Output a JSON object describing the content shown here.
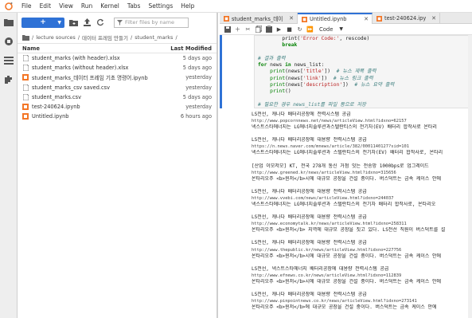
{
  "menu": [
    "File",
    "Edit",
    "View",
    "Run",
    "Kernel",
    "Tabs",
    "Settings",
    "Help"
  ],
  "filebrowser": {
    "new_label": "+",
    "filter_placeholder": "Filter files by name",
    "breadcrumb": [
      "/",
      "lecture sources",
      "/",
      "데이터 프레임 만들기",
      "/",
      "student_marks",
      "/"
    ],
    "col_name": "Name",
    "col_modified": "Last Modified",
    "files": [
      {
        "name": "student_marks (with header).xlsx",
        "modified": "5 days ago",
        "type": "file"
      },
      {
        "name": "student_marks (without header).xlsx",
        "modified": "5 days ago",
        "type": "file"
      },
      {
        "name": "student_marks_데이터 프레임 기초 명령어.ipynb",
        "modified": "yesterday",
        "type": "notebook"
      },
      {
        "name": "student_marks_csv saved.csv",
        "modified": "yesterday",
        "type": "file"
      },
      {
        "name": "student_marks.csv",
        "modified": "5 days ago",
        "type": "file"
      },
      {
        "name": "test-240624.ipynb",
        "modified": "yesterday",
        "type": "notebook"
      },
      {
        "name": "Untitled.ipynb",
        "modified": "6 hours ago",
        "type": "notebook-running"
      }
    ]
  },
  "tabs": [
    {
      "label": "student_marks_데이터 프레임",
      "active": false
    },
    {
      "label": "Untitled.ipynb",
      "active": true
    },
    {
      "label": "test-240624.ipynb",
      "active": false
    }
  ],
  "notebook_toolbar": {
    "cell_type": "Code"
  },
  "code_lines": [
    [
      {
        "t": "        print(",
        "c": ""
      },
      {
        "t": "'Error Code:'",
        "c": "str"
      },
      {
        "t": ", rescode)",
        "c": ""
      }
    ],
    [
      {
        "t": "        ",
        "c": ""
      },
      {
        "t": "break",
        "c": "kw"
      }
    ],
    [
      {
        "t": "",
        "c": ""
      }
    ],
    [
      {
        "t": "# 결과 출력",
        "c": "cm"
      }
    ],
    [
      {
        "t": "for",
        "c": "kw"
      },
      {
        "t": " news ",
        "c": ""
      },
      {
        "t": "in",
        "c": "kw"
      },
      {
        "t": " news_list:",
        "c": ""
      }
    ],
    [
      {
        "t": "    ",
        "c": ""
      },
      {
        "t": "print",
        "c": "fn"
      },
      {
        "t": "(news[",
        "c": ""
      },
      {
        "t": "'title'",
        "c": "str"
      },
      {
        "t": "])  ",
        "c": ""
      },
      {
        "t": "# 뉴스 제목 출력",
        "c": "cm"
      }
    ],
    [
      {
        "t": "    ",
        "c": ""
      },
      {
        "t": "print",
        "c": "fn"
      },
      {
        "t": "(news[",
        "c": ""
      },
      {
        "t": "'link'",
        "c": "str"
      },
      {
        "t": "])  ",
        "c": ""
      },
      {
        "t": "# 뉴스 링크 출력",
        "c": "cm"
      }
    ],
    [
      {
        "t": "    ",
        "c": ""
      },
      {
        "t": "print",
        "c": "fn"
      },
      {
        "t": "(news[",
        "c": ""
      },
      {
        "t": "'description'",
        "c": "str"
      },
      {
        "t": "])  ",
        "c": ""
      },
      {
        "t": "# 뉴스 요약 출력",
        "c": "cm"
      }
    ],
    [
      {
        "t": "    ",
        "c": ""
      },
      {
        "t": "print",
        "c": "fn"
      },
      {
        "t": "()",
        "c": ""
      }
    ],
    [
      {
        "t": "",
        "c": ""
      }
    ],
    [
      {
        "t": "# 필요한 경우 news_list를 파일 등으로 저장",
        "c": "cm"
      }
    ]
  ],
  "output_groups": [
    {
      "title": "LS전선, 캐나다 배터리공장에 전력시스템 공급",
      "url": "http://www.popcornnews.net/news/articleView.html?idxno=62157",
      "desc": "넥스트스타에너지는 LG에너지솔루션과스텔란티스의 전기차(EV) 배터리 합작사로 온타리"
    },
    {
      "title": "LS전선, 캐나다 배터리공장에 대용량 전력시스템 공급",
      "url": "https://n.news.naver.com/mnews/article/382/0001140127?sid=101",
      "desc": "넥스트스타에너지는 LG에너지솔루션과 스텔란티스의 전기차(EV) 배터리 합작사로, 온타리"
    },
    {
      "title": "[산업 이모저모] KT, 전국 278개 통신 거점 잇는 전송망 1000bps로 업그레이드",
      "url": "http://www.greened.kr/news/articleView.html?idxno=315656",
      "desc": "온타리오주 <b>윈저</b>시에 대규모 공장을 건설 중이다. 버스덕트는 금속 케이스 안에"
    },
    {
      "title": "LS전선, 캐나다 배터리공장에 대용량 전력시스템 공급",
      "url": "http://www.vvebi.com/news/articleView.html?idxno=244037",
      "desc": "넥스트스타에너지는 LG에너지솔루션과 스텔란티스의 전기차 배터리 합작사로, 온타리오"
    },
    {
      "title": "LS전선, 캐나다 배터리공장에 대용량 전력시스템 공급",
      "url": "http://www.economytalk.kr/news/articleView.html?idxno=258311",
      "desc": "온타리오주 <b>윈저</b> 지역에 대규모 공장을 짓고 있다. LS전선 직원이 버스덕트를 설"
    },
    {
      "title": "LS전선, 캐나다 배터리공장에 대용량 전력시스템 공급",
      "url": "http://www.thepublic.kr/news/articleView.html?idxno=227756",
      "desc": "온타리오주 <b>윈저</b>시에 대규모 공장을 건설 중이다. 버스덕트는 금속 케이스 안에"
    },
    {
      "title": "LS전선, 넥스트스타에너지 배터리공장에 대용량 전력시스템 공급",
      "url": "http://www.efnews.co.kr/news/articleView.html?idxno=112839",
      "desc": "온타리오주 <b>윈저</b>시에 대규모 공장을 건설 중이다. 버스덕트는 금속 케이스 안에"
    },
    {
      "title": "LS전선, 캐나다 배터리공장에 대용량 전력시스템 공급",
      "url": "http://www.pinpointnews.co.kr/news/articleView.html?idxno=273141",
      "desc": "온타리오주 <b>윈저</b>에 대규모 공장을 건설 중이다. 버스덕트는 금속 케이스 안에"
    }
  ]
}
